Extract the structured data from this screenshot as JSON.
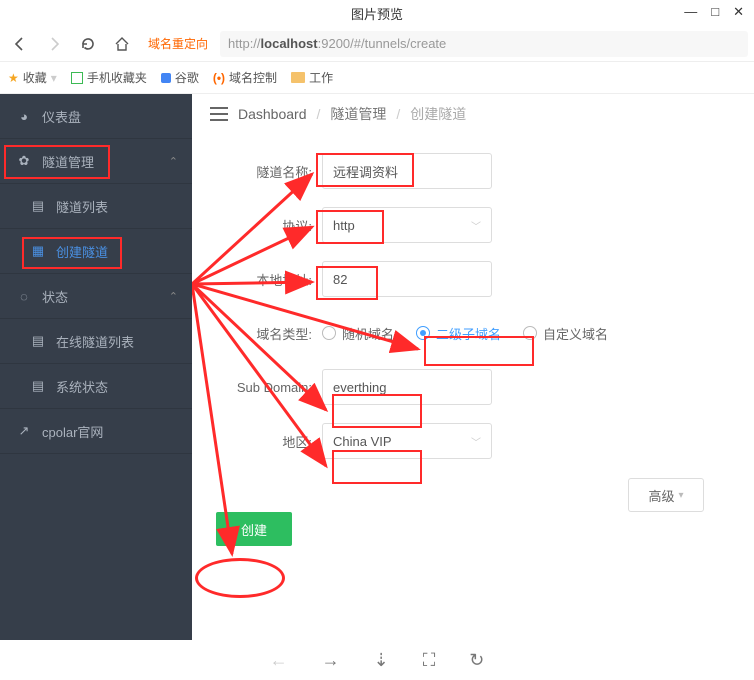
{
  "window": {
    "title": "图片预览",
    "controls": {
      "min": "—",
      "max": "□",
      "close": "✕"
    }
  },
  "nav": {
    "redirect_badge": "域名重定向",
    "url_pre": "http://",
    "url_host": "localhost",
    "url_rest": ":9200/#/tunnels/create"
  },
  "bookmarks": {
    "fav": "收藏",
    "mobile": "手机收藏夹",
    "google": "谷歌",
    "domain": "域名控制",
    "work": "工作"
  },
  "sidebar": {
    "dashboard": "仪表盘",
    "tunnel_mgmt": "隧道管理",
    "tunnel_list": "隧道列表",
    "create_tunnel": "创建隧道",
    "status": "状态",
    "online_list": "在线隧道列表",
    "sys_status": "系统状态",
    "cpolar": "cpolar官网"
  },
  "crumbs": {
    "dash": "Dashboard",
    "mid": "隧道管理",
    "cur": "创建隧道"
  },
  "form": {
    "name_label": "隧道名称:",
    "name_value": "远程调资料",
    "proto_label": "协议:",
    "proto_value": "http",
    "local_label": "本地地址:",
    "local_value": "82",
    "domain_type_label": "域名类型:",
    "radio_random": "随机域名",
    "radio_sub": "二级子域名",
    "radio_custom": "自定义域名",
    "subdomain_label": "Sub Domain:",
    "subdomain_value": "everthing",
    "region_label": "地区:",
    "region_value": "China VIP",
    "advanced": "高级",
    "submit": "创建"
  },
  "chevron": "⌄"
}
